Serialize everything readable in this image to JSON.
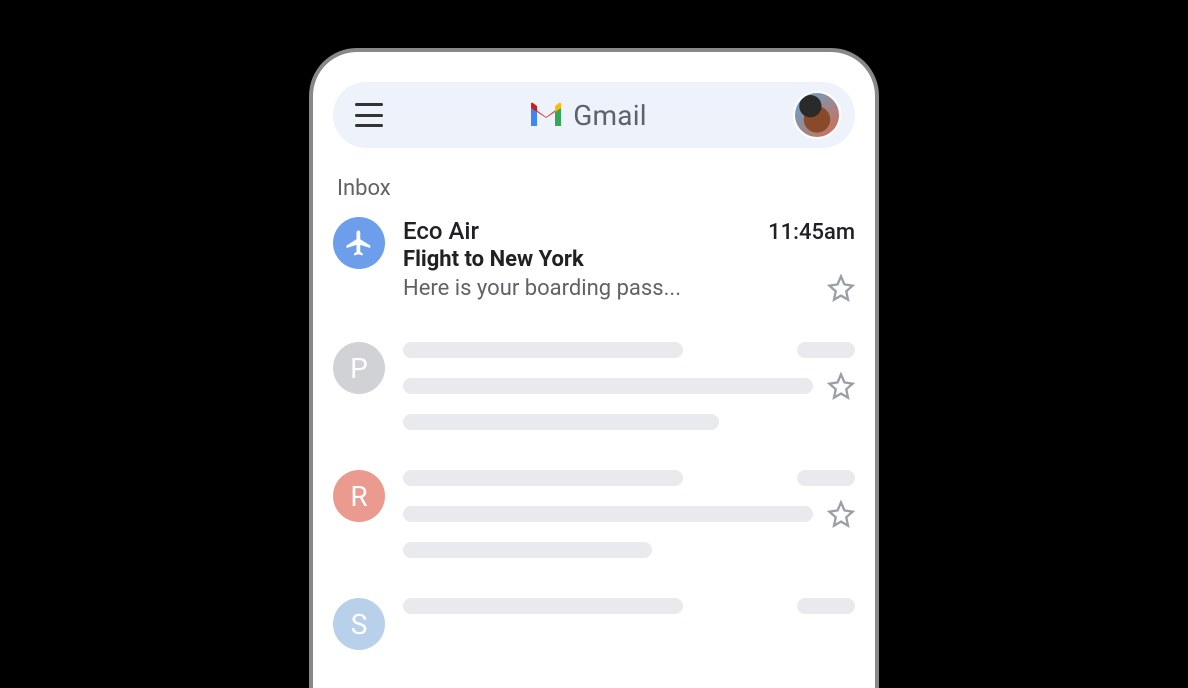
{
  "header": {
    "brand_name": "Gmail"
  },
  "section_label": "Inbox",
  "emails": [
    {
      "sender": "Eco Air",
      "time": "11:45am",
      "subject": "Flight to New York",
      "snippet": "Here is your boarding pass...",
      "avatar_icon": "airplane",
      "avatar_color": "blue",
      "starred": false
    }
  ],
  "placeholder_senders": [
    {
      "initial": "P",
      "avatar_color": "grey"
    },
    {
      "initial": "R",
      "avatar_color": "coral"
    },
    {
      "initial": "S",
      "avatar_color": "lightblue"
    }
  ]
}
